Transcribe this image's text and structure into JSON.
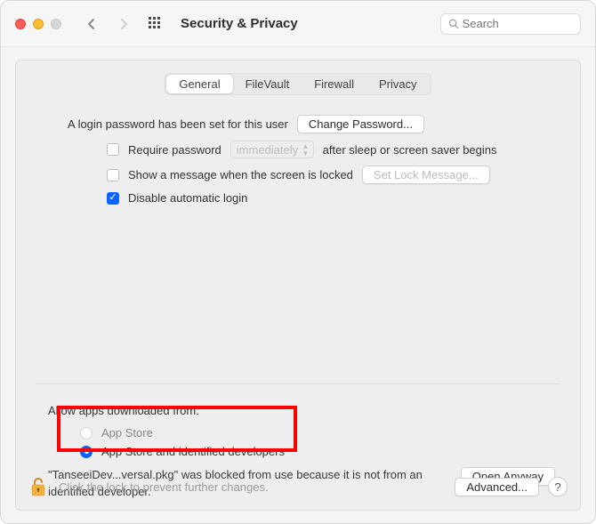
{
  "header": {
    "title": "Security & Privacy",
    "search_placeholder": "Search"
  },
  "tabs": [
    {
      "label": "General",
      "active": true
    },
    {
      "label": "FileVault",
      "active": false
    },
    {
      "label": "Firewall",
      "active": false
    },
    {
      "label": "Privacy",
      "active": false
    }
  ],
  "login": {
    "password_set_text": "A login password has been set for this user",
    "change_password_btn": "Change Password...",
    "require_password_label": "Require password",
    "require_password_popup": "immediately",
    "require_password_after": "after sleep or screen saver begins",
    "show_message_label": "Show a message when the screen is locked",
    "set_lock_message_btn": "Set Lock Message...",
    "disable_auto_login_label": "Disable automatic login"
  },
  "gatekeeper": {
    "heading": "Allow apps downloaded from:",
    "option_appstore": "App Store",
    "option_identified": "App Store and identified developers",
    "blocked_text": "\"TanseeiDev...versal.pkg\" was blocked from use because it is not from an identified developer.",
    "open_anyway_btn": "Open Anyway"
  },
  "footer": {
    "lock_text": "Click the lock to prevent further changes.",
    "advanced_btn": "Advanced...",
    "help": "?"
  }
}
